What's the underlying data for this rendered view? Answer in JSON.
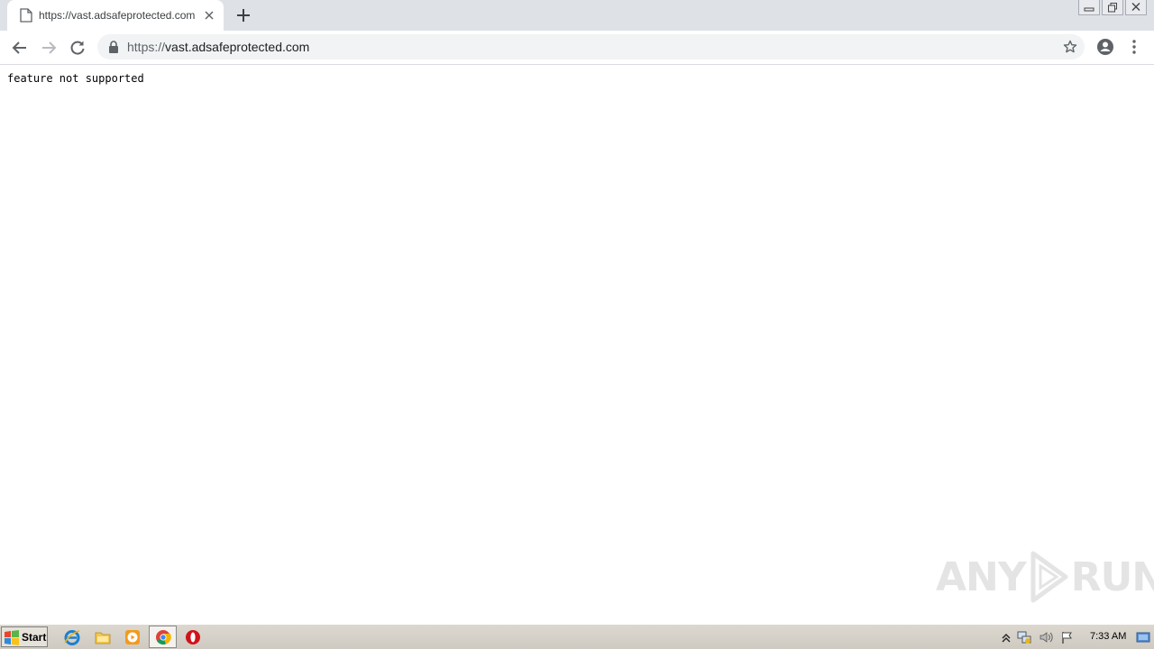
{
  "browser": {
    "tab": {
      "title": "https://vast.adsafeprotected.com"
    },
    "address": {
      "scheme": "https://",
      "host": "vast.adsafeprotected.com"
    }
  },
  "page": {
    "text": "feature not supported"
  },
  "watermark": {
    "left": "ANY",
    "right": "RUN"
  },
  "taskbar": {
    "start_label": "Start",
    "clock": "7:33 AM"
  },
  "icons": {
    "tab": "page-icon",
    "nav": [
      "back-arrow-icon",
      "forward-arrow-icon",
      "reload-icon"
    ],
    "omnibox": [
      "lock-icon",
      "star-icon"
    ],
    "toolbar_right": [
      "profile-icon",
      "menu-dots-icon"
    ],
    "taskbar": [
      "windows-logo-icon",
      "internet-explorer-icon",
      "folder-icon",
      "media-player-icon",
      "chrome-icon",
      "opera-icon"
    ],
    "tray": [
      "show-hidden-icons-icon",
      "network-icon",
      "volume-icon",
      "action-center-flag-icon",
      "show-desktop-icon"
    ]
  },
  "colors": {
    "tab_strip": "#dee1e6",
    "omnibox": "#f1f3f4",
    "taskbar": "#d4d0c8",
    "watermark": "#e4e4e4"
  }
}
